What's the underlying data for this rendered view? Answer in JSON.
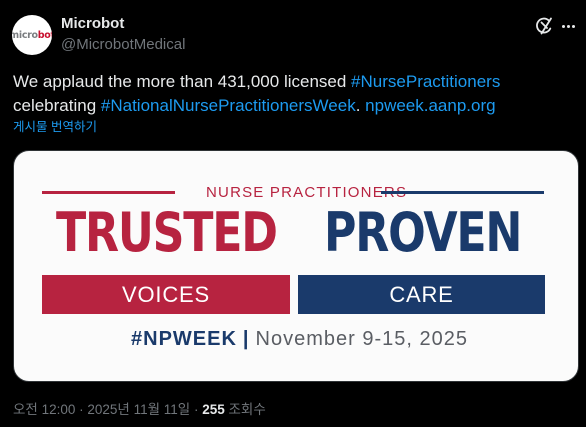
{
  "author": {
    "name": "Microbot",
    "handle": "@MicrobotMedical",
    "avatar_logo_text_1": "micro",
    "avatar_logo_text_2": "bot"
  },
  "tweet": {
    "text_1": "We applaud the more than 431,000 licensed ",
    "hashtag_1": "#NursePractitioners",
    "text_2": "celebrating ",
    "hashtag_2": "#NationalNursePractitionersWeek",
    "text_3": ". ",
    "link": "npweek.aanp.org"
  },
  "translate_label": "게시물 번역하기",
  "media": {
    "header": "NURSE PRACTITIONERS",
    "word_left": "TRUSTED",
    "word_right": "PROVEN",
    "band_left": "VOICES",
    "band_right": "CARE",
    "footer_tag": "#NPWEEK",
    "footer_sep": "|",
    "footer_date": "November 9-15, 2025",
    "colors": {
      "red": "#b72340",
      "navy": "#1a3a6b"
    }
  },
  "meta": {
    "time": "오전 12:00",
    "dot_1": " · ",
    "date": "2025년 11월 11일",
    "dot_2": " · ",
    "views_count": "255",
    "views_label": " 조회수"
  },
  "icons": {
    "grok": "grok-icon",
    "more": "more-icon"
  }
}
